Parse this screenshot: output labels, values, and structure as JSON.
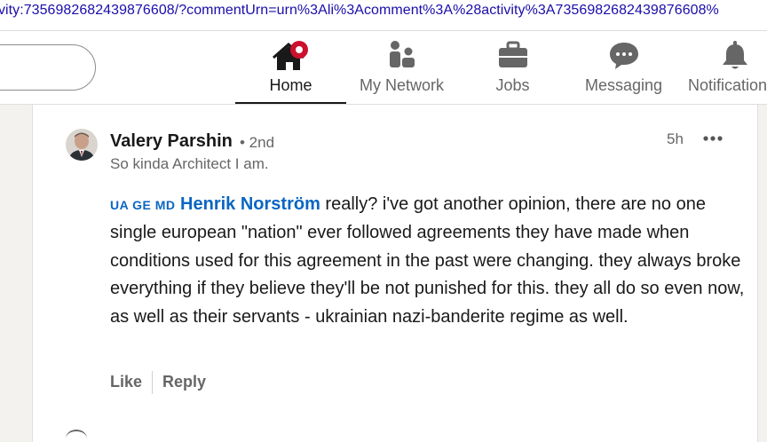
{
  "browser": {
    "url": "vity:7356982682439876608/?commentUrn=urn%3Ali%3Acomment%3A%28activity%3A7356982682439876608%"
  },
  "nav": {
    "items": [
      {
        "label": "Home",
        "icon": "home-icon",
        "badge_color": "#cb112d",
        "active": true
      },
      {
        "label": "My Network",
        "icon": "network-icon"
      },
      {
        "label": "Jobs",
        "icon": "briefcase-icon"
      },
      {
        "label": "Messaging",
        "icon": "messaging-icon"
      },
      {
        "label": "Notifications",
        "icon": "bell-icon"
      }
    ]
  },
  "comment": {
    "author": "Valery Parshin",
    "degree": "• 2nd",
    "headline": "So kinda Architect I am.",
    "time": "5h",
    "flags": "UA GE MD",
    "mention": "Henrik Norström",
    "text": " really? i've got another opinion, there are no one single european \"nation\" ever followed agreements they have made when conditions used for this agreement in the past were changing. they always broke everything if they believe they'll be not punished for this. they all do so even now, as well as their servants - ukrainian nazi-banderite regime as well.",
    "actions": {
      "like": "Like",
      "reply": "Reply"
    }
  },
  "colors": {
    "link": "#0a66c2",
    "muted": "#666666",
    "page_bg": "#f4f2ee",
    "badge": "#cb112d"
  }
}
